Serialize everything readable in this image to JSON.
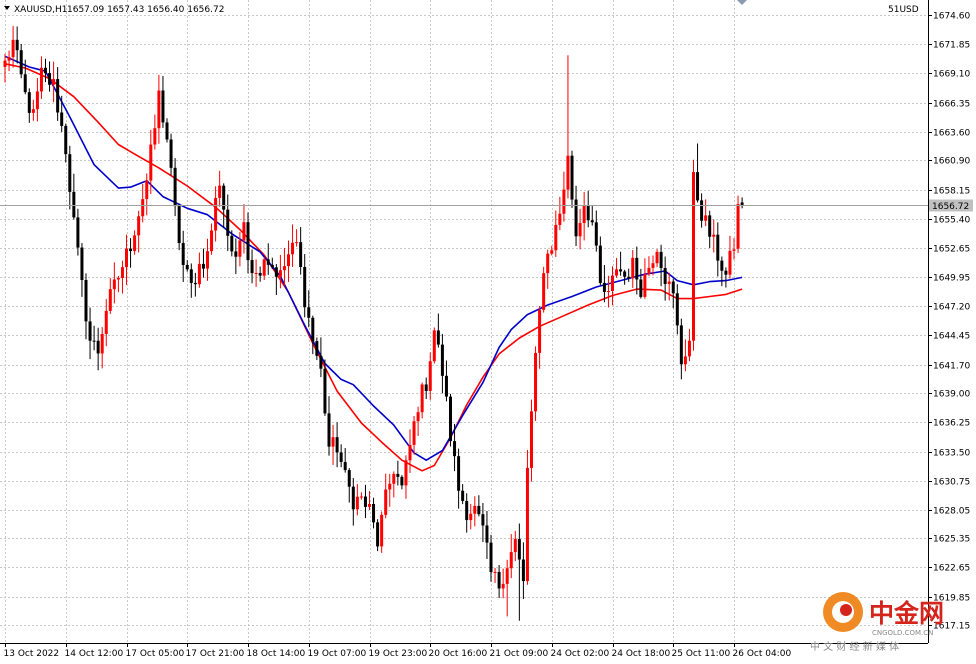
{
  "header": {
    "symbol": "XAUUSD,H1",
    "ohlc": "1657.09 1657.43 1656.40 1656.72",
    "account": "51USD"
  },
  "colors": {
    "bull": "#ff0000",
    "bear": "#000000",
    "ma_fast": "#0000cc",
    "ma_slow": "#ff0000",
    "grid": "#c8c8c8",
    "price_tag_bg": "#c0c0c0",
    "watermark_orange": "#f08a24",
    "watermark_red": "#d4241c",
    "watermark_gray": "#8a8a8a"
  },
  "watermark": {
    "cn": "中金网",
    "domain": "CNGOLD.COM.CN",
    "tagline": "中 文 财 经 新 媒 体"
  },
  "chart_data": {
    "type": "candlestick",
    "ylim": [
      1615.5,
      1676.0
    ],
    "current_price": 1656.72,
    "yticks": [
      1674.6,
      1671.85,
      1669.1,
      1666.35,
      1663.6,
      1660.9,
      1658.15,
      1655.4,
      1652.65,
      1649.95,
      1647.2,
      1644.45,
      1641.7,
      1639.0,
      1636.25,
      1633.5,
      1630.75,
      1628.05,
      1625.35,
      1622.65,
      1619.85,
      1617.15
    ],
    "ytick_labels": [
      "1674.60",
      "1671.85",
      "1669.10",
      "1666.35",
      "1663.60",
      "1660.90",
      "1658.15",
      "1655.40",
      "1652.65",
      "1649.95",
      "1647.20",
      "1644.45",
      "1641.70",
      "1639.00",
      "1636.25",
      "1633.50",
      "1630.75",
      "1628.05",
      "1625.35",
      "1622.65",
      "1619.85",
      "1617.15"
    ],
    "xticks": [
      {
        "i": 0,
        "label": "13 Oct 2022"
      },
      {
        "i": 15,
        "label": "14 Oct 12:00"
      },
      {
        "i": 30,
        "label": "17 Oct 05:00"
      },
      {
        "i": 45,
        "label": "17 Oct 21:00"
      },
      {
        "i": 60,
        "label": "18 Oct 14:00"
      },
      {
        "i": 75,
        "label": "19 Oct 07:00"
      },
      {
        "i": 90,
        "label": "19 Oct 23:00"
      },
      {
        "i": 105,
        "label": "20 Oct 16:00"
      },
      {
        "i": 120,
        "label": "21 Oct 09:00"
      },
      {
        "i": 135,
        "label": "24 Oct 02:00"
      },
      {
        "i": 150,
        "label": "24 Oct 18:00"
      },
      {
        "i": 165,
        "label": "25 Oct 11:00"
      },
      {
        "i": 180,
        "label": "26 Oct 04:00"
      }
    ],
    "anchors": [
      [
        0,
        1670.0
      ],
      [
        2,
        1672.0
      ],
      [
        5,
        1667.0
      ],
      [
        7,
        1665.0
      ],
      [
        9,
        1669.0
      ],
      [
        12,
        1668.0
      ],
      [
        15,
        1662.0
      ],
      [
        17,
        1655.0
      ],
      [
        19,
        1649.0
      ],
      [
        21,
        1644.0
      ],
      [
        23,
        1643.0
      ],
      [
        25,
        1647.0
      ],
      [
        27,
        1649.0
      ],
      [
        29,
        1651.0
      ],
      [
        31,
        1653.0
      ],
      [
        33,
        1656.0
      ],
      [
        35,
        1659.0
      ],
      [
        37,
        1664.0
      ],
      [
        38,
        1667.0
      ],
      [
        40,
        1663.0
      ],
      [
        42,
        1656.0
      ],
      [
        44,
        1651.0
      ],
      [
        46,
        1649.0
      ],
      [
        48,
        1651.0
      ],
      [
        50,
        1652.0
      ],
      [
        52,
        1657.0
      ],
      [
        53,
        1659.0
      ],
      [
        55,
        1654.0
      ],
      [
        57,
        1651.0
      ],
      [
        59,
        1656.0
      ],
      [
        60,
        1652.0
      ],
      [
        62,
        1650.0
      ],
      [
        64,
        1652.0
      ],
      [
        66,
        1651.0
      ],
      [
        68,
        1650.0
      ],
      [
        70,
        1652.0
      ],
      [
        72,
        1653.0
      ],
      [
        74,
        1648.0
      ],
      [
        76,
        1644.0
      ],
      [
        78,
        1641.0
      ],
      [
        80,
        1634.0
      ],
      [
        82,
        1634.0
      ],
      [
        84,
        1631.0
      ],
      [
        86,
        1629.0
      ],
      [
        88,
        1629.0
      ],
      [
        90,
        1628.0
      ],
      [
        92,
        1625.0
      ],
      [
        94,
        1629.0
      ],
      [
        96,
        1632.0
      ],
      [
        98,
        1630.0
      ],
      [
        100,
        1634.0
      ],
      [
        102,
        1638.0
      ],
      [
        104,
        1640.0
      ],
      [
        106,
        1645.0
      ],
      [
        108,
        1641.0
      ],
      [
        110,
        1635.0
      ],
      [
        112,
        1630.0
      ],
      [
        114,
        1628.0
      ],
      [
        116,
        1628.0
      ],
      [
        118,
        1626.0
      ],
      [
        120,
        1622.0
      ],
      [
        122,
        1621.0
      ],
      [
        124,
        1623.0
      ],
      [
        126,
        1625.0
      ],
      [
        128,
        1621.0
      ],
      [
        129,
        1632.0
      ],
      [
        131,
        1642.0
      ],
      [
        133,
        1651.0
      ],
      [
        135,
        1653.0
      ],
      [
        137,
        1656.0
      ],
      [
        139,
        1661.0
      ],
      [
        141,
        1654.0
      ],
      [
        143,
        1657.0
      ],
      [
        145,
        1655.0
      ],
      [
        147,
        1649.0
      ],
      [
        149,
        1648.0
      ],
      [
        151,
        1651.0
      ],
      [
        153,
        1650.0
      ],
      [
        155,
        1651.0
      ],
      [
        157,
        1649.0
      ],
      [
        159,
        1651.0
      ],
      [
        161,
        1653.0
      ],
      [
        163,
        1650.0
      ],
      [
        165,
        1648.0
      ],
      [
        167,
        1642.0
      ],
      [
        169,
        1644.0
      ],
      [
        170,
        1659.0
      ],
      [
        172,
        1656.0
      ],
      [
        174,
        1654.0
      ],
      [
        176,
        1652.0
      ],
      [
        178,
        1650.0
      ],
      [
        180,
        1653.0
      ],
      [
        182,
        1656.72
      ]
    ],
    "ma_fast": [
      [
        0,
        1670.7
      ],
      [
        6,
        1669.7
      ],
      [
        10,
        1669.3
      ],
      [
        16,
        1665.0
      ],
      [
        22,
        1660.5
      ],
      [
        28,
        1658.3
      ],
      [
        31,
        1658.4
      ],
      [
        35,
        1659.0
      ],
      [
        39,
        1657.5
      ],
      [
        45,
        1656.4
      ],
      [
        50,
        1655.8
      ],
      [
        56,
        1654.0
      ],
      [
        63,
        1652.3
      ],
      [
        68,
        1650.0
      ],
      [
        74,
        1645.4
      ],
      [
        79,
        1641.8
      ],
      [
        83,
        1640.3
      ],
      [
        86,
        1639.8
      ],
      [
        91,
        1637.8
      ],
      [
        96,
        1636.0
      ],
      [
        101,
        1633.4
      ],
      [
        104,
        1632.7
      ],
      [
        108,
        1633.6
      ],
      [
        113,
        1636.9
      ],
      [
        118,
        1640.0
      ],
      [
        122,
        1643.3
      ],
      [
        125,
        1645.0
      ],
      [
        129,
        1646.4
      ],
      [
        134,
        1647.3
      ],
      [
        140,
        1648.1
      ],
      [
        146,
        1649.0
      ],
      [
        152,
        1649.6
      ],
      [
        158,
        1650.2
      ],
      [
        163,
        1650.5
      ],
      [
        166,
        1649.6
      ],
      [
        170,
        1649.2
      ],
      [
        174,
        1649.5
      ],
      [
        178,
        1649.6
      ],
      [
        182,
        1649.9
      ]
    ],
    "ma_slow": [
      [
        0,
        1670.0
      ],
      [
        5,
        1669.6
      ],
      [
        11,
        1668.6
      ],
      [
        17,
        1666.9
      ],
      [
        23,
        1664.5
      ],
      [
        28,
        1662.4
      ],
      [
        32,
        1661.5
      ],
      [
        38,
        1660.2
      ],
      [
        45,
        1658.5
      ],
      [
        52,
        1656.5
      ],
      [
        58,
        1654.4
      ],
      [
        64,
        1652.0
      ],
      [
        70,
        1648.5
      ],
      [
        76,
        1643.7
      ],
      [
        82,
        1639.2
      ],
      [
        88,
        1636.2
      ],
      [
        93,
        1634.4
      ],
      [
        98,
        1632.7
      ],
      [
        103,
        1631.7
      ],
      [
        106,
        1632.2
      ],
      [
        110,
        1634.8
      ],
      [
        114,
        1637.9
      ],
      [
        118,
        1640.5
      ],
      [
        122,
        1642.7
      ],
      [
        127,
        1644.2
      ],
      [
        132,
        1645.3
      ],
      [
        138,
        1646.3
      ],
      [
        144,
        1647.3
      ],
      [
        150,
        1648.2
      ],
      [
        156,
        1648.8
      ],
      [
        162,
        1648.7
      ],
      [
        166,
        1647.9
      ],
      [
        170,
        1647.9
      ],
      [
        174,
        1648.1
      ],
      [
        178,
        1648.3
      ],
      [
        182,
        1648.8
      ]
    ]
  }
}
